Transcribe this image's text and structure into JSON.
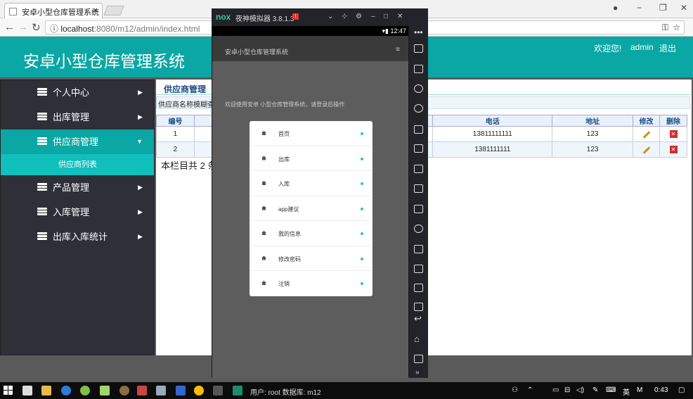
{
  "browser": {
    "tab_title": "安卓小型仓库管理系统",
    "tab_close": "×",
    "url_host": "localhost",
    "url_path": ":8080/m12/admin/index.html",
    "window_controls": [
      "−",
      "❐",
      "✕"
    ]
  },
  "header": {
    "title": "安卓小型仓库管理系统",
    "welcome": "欢迎您!",
    "username": "admin",
    "logout": "退出"
  },
  "sidebar": {
    "items": [
      {
        "label": "个人中心",
        "caret": "▶",
        "active": false
      },
      {
        "label": "出库管理",
        "caret": "▶",
        "active": false
      },
      {
        "label": "供应商管理",
        "caret": "▼",
        "active": true
      },
      {
        "label": "产品管理",
        "caret": "▶",
        "active": false
      },
      {
        "label": "入库管理",
        "caret": "▶",
        "active": false
      },
      {
        "label": "出库入库统计",
        "caret": "▶",
        "active": false
      }
    ],
    "submenu_label": "供应商列表"
  },
  "content": {
    "tab_label": "供应商管理",
    "search_label": "供应商名称模糊查询",
    "columns": [
      "编号",
      "电话",
      "地址",
      "修改",
      "删除"
    ],
    "rows": [
      {
        "id": "1",
        "phone": "13811111111",
        "address": "123"
      },
      {
        "id": "2",
        "phone": "1381111111",
        "address": "123"
      }
    ],
    "record_count": "本栏目共 2 条"
  },
  "emulator": {
    "logo": "nox",
    "title": "夜神模拟器 3.8.1.3",
    "time": "12:47",
    "app_title": "安卓小型仓库管理系统",
    "menu_glyph": "≡",
    "welcome_text": "欢迎使用安卓 小型仓库管理系统，请登录后操作",
    "menu_items": [
      "首页",
      "出库",
      "入库",
      "app建议",
      "我的信息",
      "修改密码",
      "注销"
    ]
  },
  "taskbar": {
    "status_text": "用户: root  数据库: m12",
    "ime": "英",
    "ime_mode": "M",
    "clock": "0:43"
  },
  "colors": {
    "accent": "#0aa7a4",
    "sidebar_bg": "#2f2f38",
    "submenu": "#11bfbc"
  }
}
